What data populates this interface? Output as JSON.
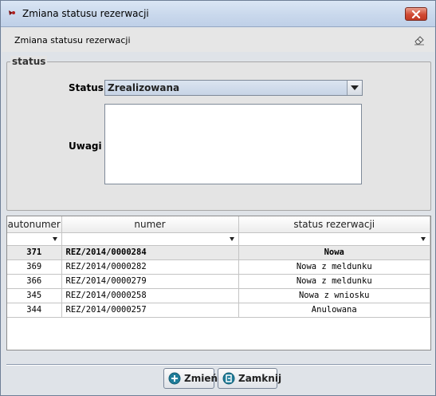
{
  "window": {
    "title": "Zmiana statusu rezerwacji"
  },
  "header": {
    "title": "Zmiana statusu rezerwacji"
  },
  "form": {
    "legend": "status",
    "status_label": "Status",
    "status_value": "Zrealizowana",
    "uwagi_label": "Uwagi",
    "uwagi_value": ""
  },
  "table": {
    "columns": [
      "autonumer",
      "numer",
      "status rezerwacji"
    ],
    "rows": [
      {
        "autonumer": "371",
        "numer": "REZ/2014/0000284",
        "status": "Nowa",
        "selected": true
      },
      {
        "autonumer": "369",
        "numer": "REZ/2014/0000282",
        "status": "Nowa z meldunku",
        "selected": false
      },
      {
        "autonumer": "366",
        "numer": "REZ/2014/0000279",
        "status": "Nowa z meldunku",
        "selected": false
      },
      {
        "autonumer": "345",
        "numer": "REZ/2014/0000258",
        "status": "Nowa z wniosku",
        "selected": false
      },
      {
        "autonumer": "344",
        "numer": "REZ/2014/0000257",
        "status": "Anulowana",
        "selected": false
      }
    ]
  },
  "buttons": {
    "zmien": "Zmień",
    "zamknij": "Zamknij"
  },
  "icons": {
    "window": "app-icon",
    "close": "close-icon",
    "header": "eraser-icon",
    "dropdown": "chevron-down-icon",
    "zmien": "plus-circle-icon",
    "zamknij": "exit-icon"
  },
  "colors": {
    "close_button": "#c84a34",
    "button_icon": "#1f7d9a"
  }
}
